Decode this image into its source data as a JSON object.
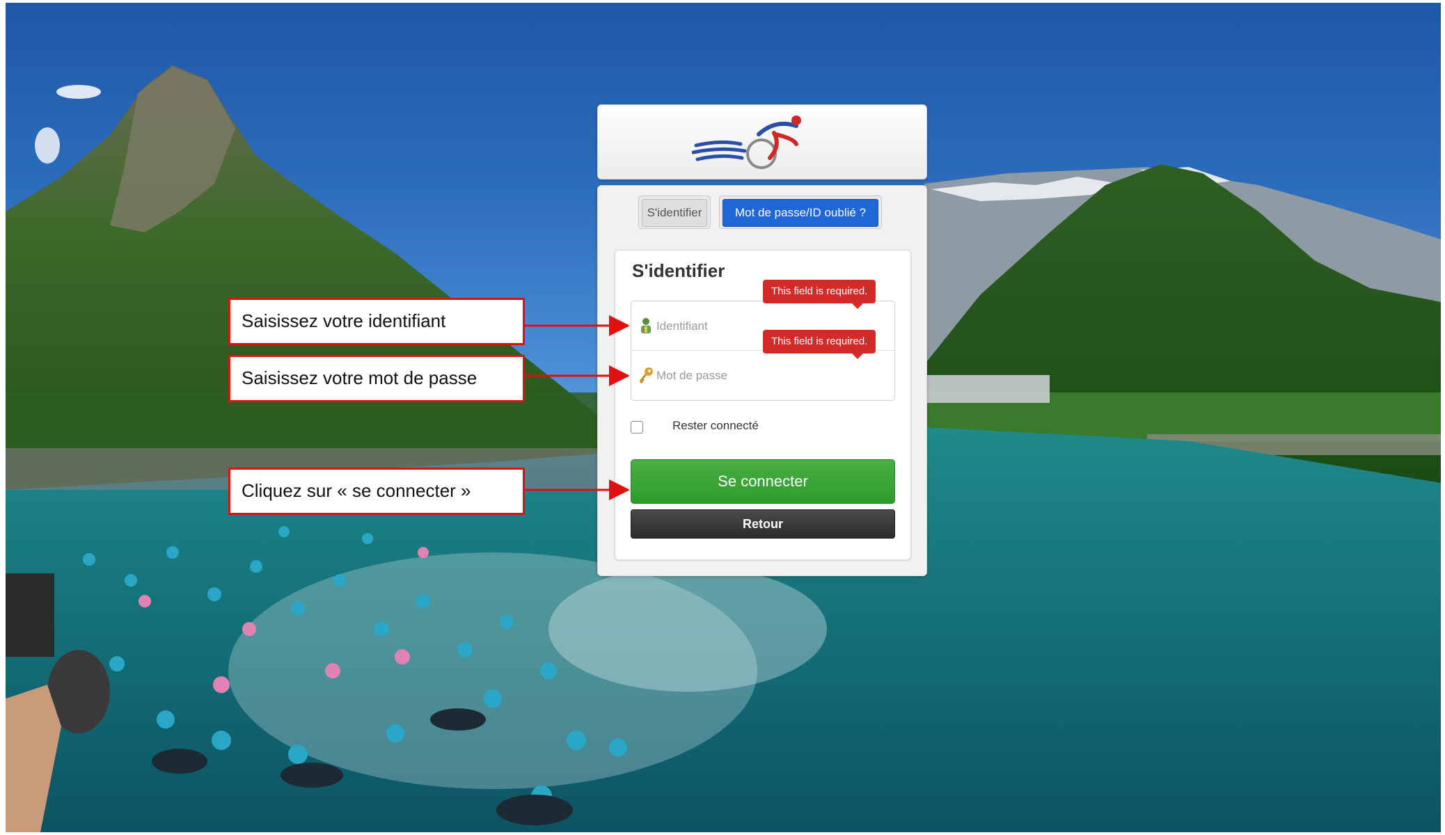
{
  "login": {
    "tab_login": "S'identifier",
    "tab_forgot": "Mot de passe/ID oublié ?",
    "form_title": "S'identifier",
    "username_placeholder": "Identifiant",
    "password_placeholder": "Mot de passe",
    "required_message": "This field is required.",
    "remember_label": "Rester connecté",
    "remember_checked": false,
    "connect_button": "Se connecter",
    "back_button": "Retour",
    "logo_icon": "triathlon-swim-bike-run-logo"
  },
  "callouts": {
    "username": "Saisissez votre identifiant",
    "password": "Saisissez votre mot de passe",
    "connect": "Cliquez sur « se connecter »"
  },
  "colors": {
    "connect_green": "#3aa336",
    "forgot_blue": "#1f66d6",
    "error_red": "#d42a2a",
    "callout_red": "#e01010",
    "back_dark": "#333333"
  }
}
